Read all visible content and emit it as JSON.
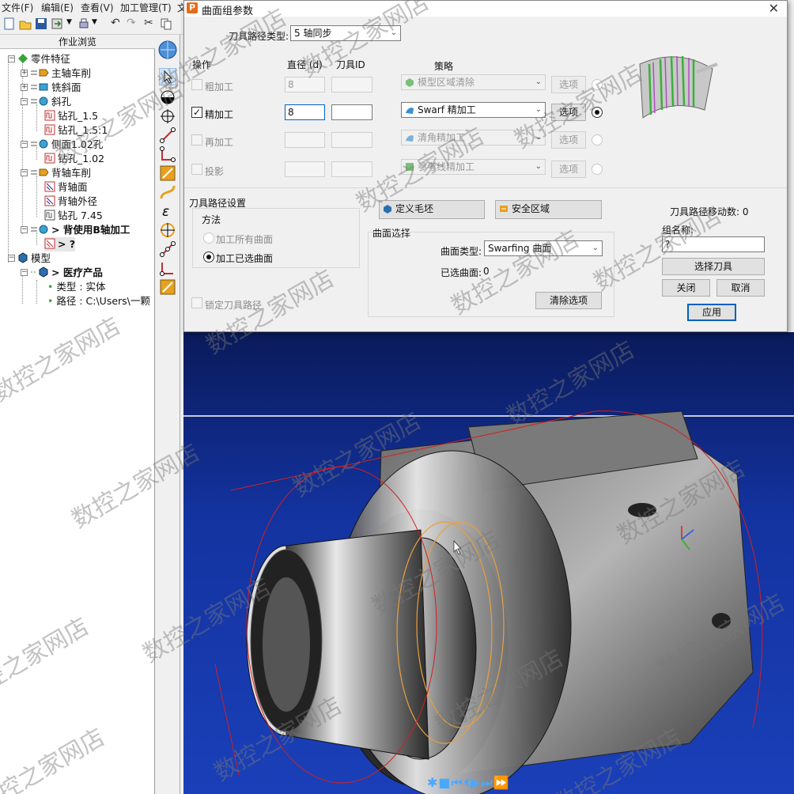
{
  "menu": [
    "文件(F)",
    "编辑(E)",
    "查看(V)",
    "加工管理(T)",
    "文"
  ],
  "tree": {
    "header": "作业浏览",
    "nodes": [
      {
        "label": "零件特征",
        "bold": false
      },
      {
        "label": "主轴车削",
        "bold": false
      },
      {
        "label": "铣斜面",
        "bold": false
      },
      {
        "label": "斜孔",
        "bold": false
      },
      {
        "label": "钻孔_1.5",
        "bold": false
      },
      {
        "label": "钻孔_1.5:1",
        "bold": false
      },
      {
        "label": "侧面1.02孔",
        "bold": false
      },
      {
        "label": "钻孔_1.02",
        "bold": false
      },
      {
        "label": "背轴车削",
        "bold": false
      },
      {
        "label": "背轴面",
        "bold": false
      },
      {
        "label": "背轴外径",
        "bold": false
      },
      {
        "label": "钻孔 7.45",
        "bold": false
      },
      {
        "label": "> 背使用B轴加工",
        "bold": true
      },
      {
        "label": "> ?",
        "bold": true
      },
      {
        "label": "模型",
        "bold": false
      },
      {
        "label": "> 医疗产品",
        "bold": true
      },
      {
        "label": "类型 : 实体",
        "bold": false
      },
      {
        "label": "路径 : C:\\Users\\一颗",
        "bold": false
      }
    ]
  },
  "dialog": {
    "title": "曲面组参数",
    "toolpath_type_label": "刀具路径类型:",
    "toolpath_type_value": "5 轴同步",
    "col_operation": "操作",
    "col_diameter": "直径 (d)",
    "col_tool_id": "刀具ID",
    "col_strategy": "策略",
    "ops": [
      {
        "label": "粗加工",
        "enabled": false,
        "checked": false,
        "diameter": "8",
        "tool_id": "",
        "strategy": "模型区域清除",
        "options": "选项",
        "selected": false
      },
      {
        "label": "精加工",
        "enabled": true,
        "checked": true,
        "diameter": "8",
        "tool_id": "",
        "strategy": "Swarf 精加工",
        "options": "选项",
        "selected": true
      },
      {
        "label": "再加工",
        "enabled": false,
        "checked": false,
        "diameter": "",
        "tool_id": "",
        "strategy": "清角精加工",
        "options": "选项",
        "selected": false
      },
      {
        "label": "投影",
        "enabled": false,
        "checked": false,
        "diameter": "",
        "tool_id": "",
        "strategy": "参考线精加工",
        "options": "选项",
        "selected": false
      }
    ],
    "path_settings": {
      "title": "刀具路径设置",
      "method_label": "方法",
      "method_all": "加工所有曲面",
      "method_selected": "加工已选曲面",
      "lock_path": "锁定刀具路径"
    },
    "define_stock": "定义毛坯",
    "safe_zone": "安全区域",
    "surface_select": {
      "title": "曲面选择",
      "type_label": "曲面类型:",
      "type_value": "Swarfing 曲面",
      "selected_label": "已选曲面:",
      "selected_count": "0",
      "clear": "清除选项"
    },
    "moves_label": "刀具路径移动数: 0",
    "group_name_label": "组名称:",
    "group_name_value": "?",
    "select_tool": "选择刀具",
    "close": "关闭",
    "cancel": "取消",
    "apply": "应用"
  },
  "watermark": "数控之家网店",
  "colors": {
    "accent": "#0060c0",
    "viewport_top": "#0a1a5a",
    "viewport_bottom": "#1a3fb8"
  }
}
